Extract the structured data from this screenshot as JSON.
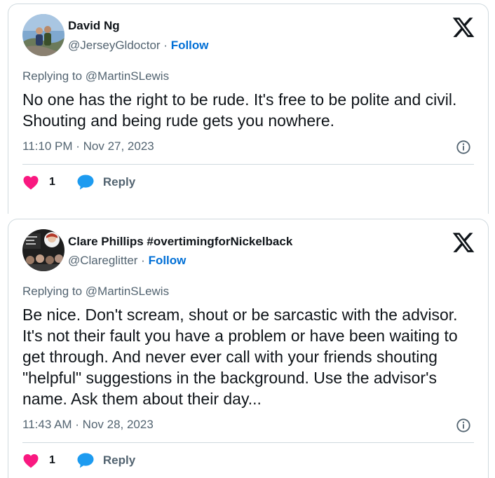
{
  "tweets": [
    {
      "author_name": "David Ng",
      "handle": "@JerseyGldoctor",
      "separator": " · ",
      "follow_label": "Follow",
      "replying_prefix": "Replying to ",
      "replying_to": "@MartinSLewis",
      "text": "No one has the right to be rude. It's free to be polite and civil. Shouting and being rude gets you nowhere.",
      "timestamp": "11:10 PM · Nov 27, 2023",
      "like_count": "1",
      "reply_label": "Reply",
      "icons": {
        "like": "heart-icon",
        "reply": "speech-bubble-icon",
        "brand": "x-logo-icon",
        "info": "info-icon"
      }
    },
    {
      "author_name": "Clare Phillips #overtimingforNickelback",
      "handle": "@Clareglitter",
      "separator": " · ",
      "follow_label": "Follow",
      "replying_prefix": "Replying to ",
      "replying_to": "@MartinSLewis",
      "text": "Be nice. Don't scream, shout or be sarcastic with the advisor. It's not their fault you have a problem or have been waiting to get through. And never ever call with your friends shouting \"helpful\" suggestions in the background. Use the advisor's name. Ask them about their day...",
      "timestamp": "11:43 AM · Nov 28, 2023",
      "like_count": "1",
      "reply_label": "Reply",
      "icons": {
        "like": "heart-icon",
        "reply": "speech-bubble-icon",
        "brand": "x-logo-icon",
        "info": "info-icon"
      }
    }
  ],
  "colors": {
    "link_blue": "#006fd6",
    "heart_red": "#f91880",
    "reply_blue": "#1d9bf0",
    "secondary_text": "#536471",
    "primary_text": "#0f1419",
    "border": "#cfd9de"
  }
}
